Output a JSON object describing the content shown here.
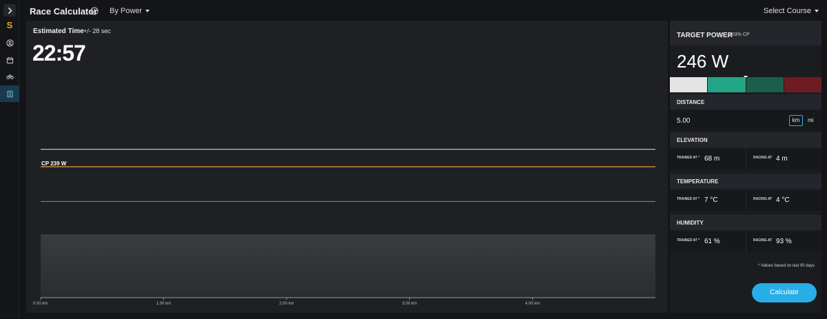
{
  "app": {
    "title": "Race Calculator",
    "mode": "By Power",
    "course_select": "Select Course"
  },
  "sidebar": {
    "items": [
      {
        "name": "expand",
        "icon": "chevron-right-icon"
      },
      {
        "name": "logo",
        "icon": "logo-s",
        "text": "S"
      },
      {
        "name": "profile",
        "icon": "user-circle-icon"
      },
      {
        "name": "calendar",
        "icon": "calendar-icon"
      },
      {
        "name": "activities",
        "icon": "bike-icon"
      },
      {
        "name": "calculator",
        "icon": "calculator-icon",
        "active": true
      }
    ]
  },
  "estimate": {
    "label": "Estimated Time",
    "margin": "+/- 28 sec",
    "time": "22:57"
  },
  "chart_data": {
    "type": "line",
    "x_unit": "km",
    "xlim": [
      0,
      5
    ],
    "x_ticks": [
      "0.00 km",
      "1.00 km",
      "2.00 km",
      "3.00 km",
      "4.00 km"
    ],
    "reference_lines": [
      {
        "label": "CP 239 W",
        "value": 239,
        "color": "#e8a33a"
      }
    ],
    "series": [
      {
        "values": [
          246,
          246
        ],
        "color": "#e8e8e8"
      },
      {
        "values": [
          225,
          225
        ],
        "color": "#27aee6"
      }
    ],
    "elevation_profile": {
      "fill_top": "#3a3c40",
      "fill_bottom": "#2a2c30"
    }
  },
  "target_power": {
    "title": "TARGET POWER",
    "percent": "103% CP",
    "value": "246 W",
    "zone_marker_fraction": 0.5,
    "zones": [
      "#e4e4e4",
      "#22a487",
      "#1c5e4c",
      "#6e1c22"
    ]
  },
  "distance": {
    "title": "DISTANCE",
    "value": "5.00",
    "unit_km": "km",
    "unit_mi": "mi"
  },
  "elevation": {
    "title": "ELEVATION",
    "trained_label": "TRAINED AT *",
    "trained_value": "68 m",
    "racing_label": "RACING AT",
    "racing_value": "4 m"
  },
  "temperature": {
    "title": "TEMPERATURE",
    "trained_label": "TRAINED AT *",
    "trained_value": "7 °C",
    "racing_label": "RACING AT",
    "racing_value": "4 °C"
  },
  "humidity": {
    "title": "HUMIDITY",
    "trained_label": "TRAINED AT *",
    "trained_value": "61 %",
    "racing_label": "RACING AT",
    "racing_value": "93 %"
  },
  "footnote": "* Values based on last 90 days",
  "calculate_label": "Calculate"
}
